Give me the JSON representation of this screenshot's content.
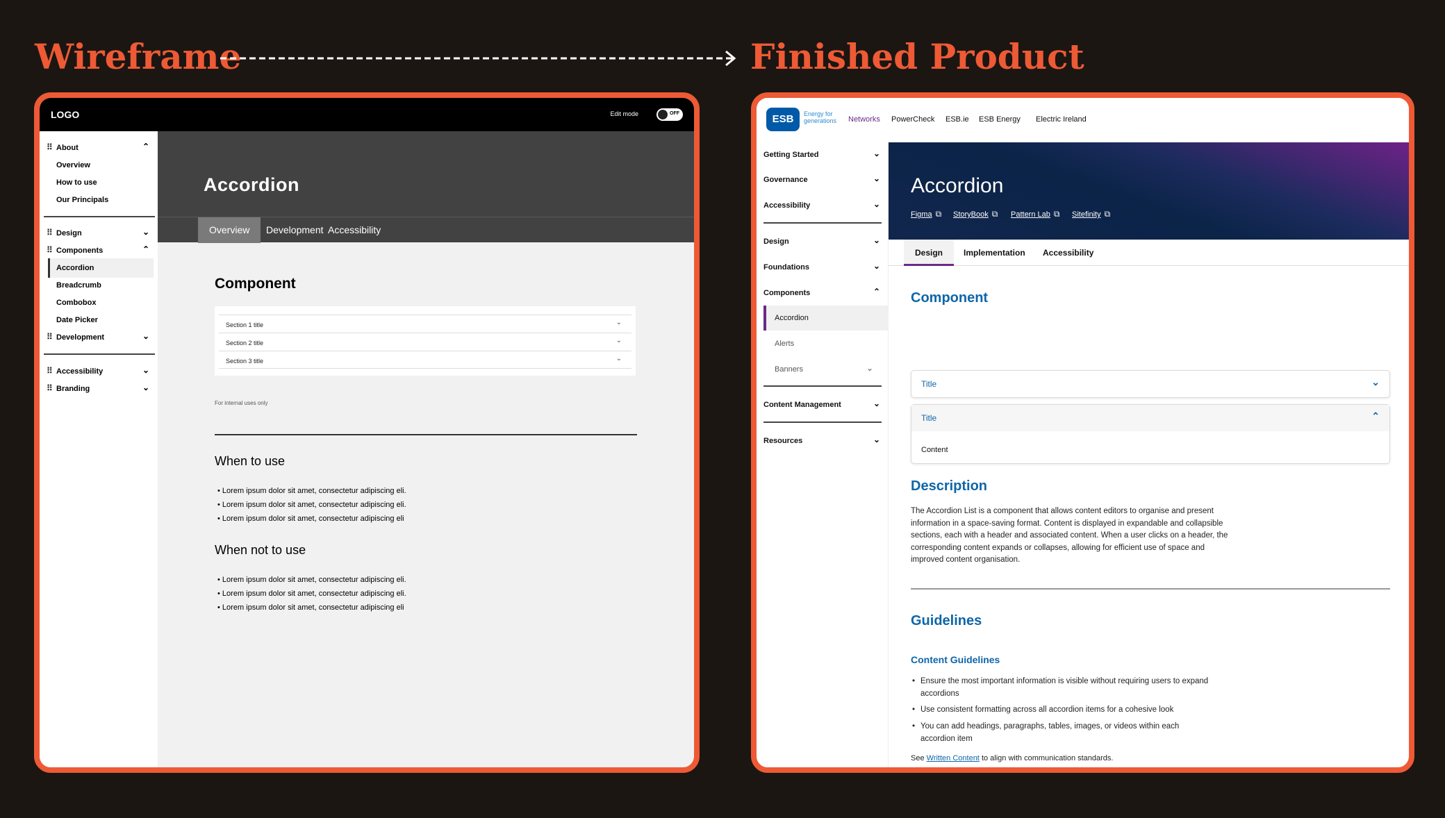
{
  "headings": {
    "left": "Wireframe",
    "right": "Finished Product"
  },
  "colors": {
    "accent": "#ee5a35",
    "background": "#1b1612",
    "esb_purple": "#6b2a86",
    "esb_blue": "#0e66a8"
  },
  "wireframe": {
    "logo": "LOGO",
    "edit_mode_label": "Edit mode",
    "toggle_label": "OFF",
    "sidebar": {
      "about": "About",
      "overview": "Overview",
      "how_to_use": "How to use",
      "our_principals": "Our Principals",
      "design": "Design",
      "components": "Components",
      "accordion": "Accordion",
      "breadcrumb": "Breadcrumb",
      "combobox": "Combobox",
      "date_picker": "Date Picker",
      "development": "Development",
      "accessibility": "Accessibility",
      "branding": "Branding"
    },
    "page_title": "Accordion",
    "tabs": [
      "Overview",
      "Development",
      "Accessibility"
    ],
    "component_heading": "Component",
    "accordion_rows": [
      "Section 1 title",
      "Section 2 title",
      "Section 3 title"
    ],
    "note": "For internal uses only",
    "when_to_use": "When to use",
    "when_to_use_items": [
      "Lorem ipsum dolor sit amet, consectetur adipiscing eli.",
      "Lorem ipsum dolor sit amet, consectetur adipiscing eli.",
      "Lorem ipsum dolor sit amet, consectetur adipiscing eli"
    ],
    "when_not_to_use": "When not to use",
    "when_not_to_use_items": [
      "Lorem ipsum dolor sit amet, consectetur adipiscing eli.",
      "Lorem ipsum dolor sit amet, consectetur adipiscing eli.",
      "Lorem ipsum dolor sit amet, consectetur adipiscing eli"
    ]
  },
  "finished": {
    "logo_text": "ESB",
    "logo_tagline": "Energy for generations",
    "nav": [
      "Networks",
      "PowerCheck",
      "ESB.ie",
      "ESB Energy",
      "Electric Ireland"
    ],
    "sidebar": {
      "getting_started": "Getting Started",
      "governance": "Governance",
      "accessibility": "Accessibility",
      "design": "Design",
      "foundations": "Foundations",
      "components": "Components",
      "accordion": "Accordion",
      "alerts": "Alerts",
      "banners": "Banners",
      "content_management": "Content Management",
      "resources": "Resources"
    },
    "page_title": "Accordion",
    "links": [
      "Figma",
      "StoryBook",
      "Pattern Lab",
      "Sitefinity"
    ],
    "tabs": [
      "Design",
      "Implementation",
      "Accessibility"
    ],
    "component_heading": "Component",
    "accordion_title_1": "Title",
    "accordion_title_2": "Title",
    "accordion_content": "Content",
    "description_heading": "Description",
    "description": "The Accordion List is a component that allows content editors to organise and present information in a space-saving format. Content is displayed in expandable and collapsible sections, each with a header and associated content. When a user clicks on a header, the corresponding content expands or collapses, allowing for efficient use of space and improved content organisation.",
    "guidelines_heading": "Guidelines",
    "content_guidelines_heading": "Content Guidelines",
    "guidelines": [
      "Ensure the most important information is visible without requiring users to expand accordions",
      "Use consistent formatting across all accordion items for a cohesive look",
      "You can add headings, paragraphs, tables, images, or videos within each accordion item"
    ],
    "see_prefix": "See",
    "see_link": "Written Content",
    "see_suffix": "to align with communication standards."
  }
}
